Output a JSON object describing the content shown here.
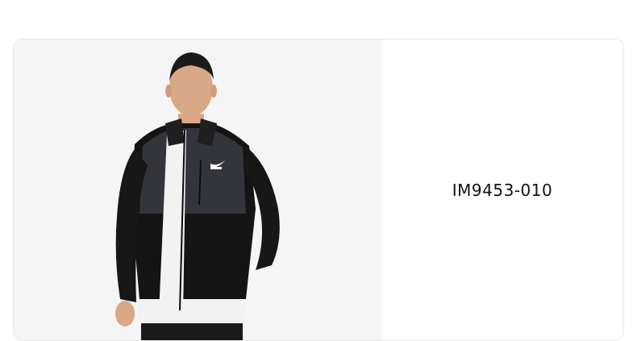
{
  "product": {
    "code": "IM9453-010"
  },
  "image": {
    "icon": "product-photo-jacket",
    "background_color": "#f5f5f5",
    "jacket_color": "#141414",
    "panel_color": "#33353a",
    "shirt_color": "#f2f2f2",
    "skin_color": "#d9a887"
  }
}
